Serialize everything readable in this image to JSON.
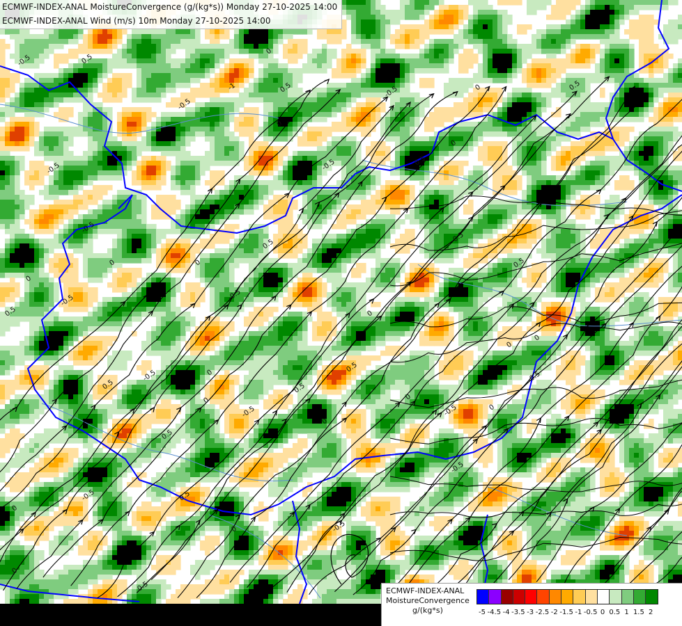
{
  "header": {
    "line1": "ECMWF-INDEX-ANAL MoistureConvergence (g/(kg*s)) Monday 27-10-2025 14:00",
    "line2": "ECMWF-INDEX-ANAL Wind (m/s) 10m Monday 27-10-2025 14:00"
  },
  "legend": {
    "model": "ECMWF-INDEX-ANAL",
    "field": "MoistureConvergence",
    "unit": "g/(kg*s)",
    "ticks": [
      "-5",
      "-4.5",
      "-4",
      "-3.5",
      "-3",
      "-2.5",
      "-2",
      "-1.5",
      "-1",
      "-0.5",
      "0",
      "0.5",
      "1",
      "1.5",
      "2"
    ],
    "colors": [
      "#0000ff",
      "#8b00ff",
      "#990000",
      "#cc0000",
      "#ff0000",
      "#ff4400",
      "#ff8800",
      "#ffaa00",
      "#ffcc55",
      "#ffe0a0",
      "#ffffff",
      "#c8eac0",
      "#7fcc7f",
      "#33aa33",
      "#008800"
    ]
  },
  "contour_labels": [
    "-0.5",
    "0",
    "0.5",
    "-0.5",
    "0",
    "-1",
    "0.5",
    "-0.5",
    "0",
    "0.5",
    "-0.5",
    "0",
    "0.5",
    "-0.5",
    "0",
    "0",
    "-0.5",
    "0.5",
    "0",
    "-0.5",
    "0.5",
    "0",
    "-0.5",
    "0",
    "0.5",
    "-0.5",
    "0",
    "0.5",
    "0",
    "-0.5",
    "0.5",
    "0",
    "-0.5",
    "0",
    "0.5",
    "-0.5",
    "0",
    "0.5",
    "0",
    "-0.5",
    "0",
    "0.5",
    "-0.5",
    "0",
    "-0.5",
    "0.5",
    "0",
    "-0.5"
  ],
  "colors": {
    "border": "#0000ff",
    "streamline": "#000000",
    "river": "#5a8fd0"
  }
}
